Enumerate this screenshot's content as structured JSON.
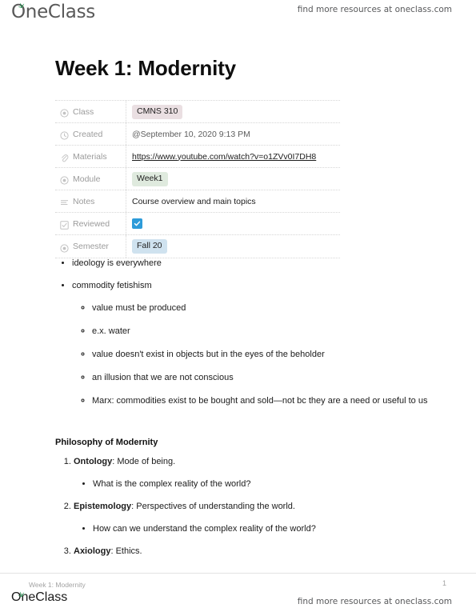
{
  "header": {
    "logo_text": "OneClass",
    "logo_icon": "leaf-sprout-icon",
    "tagline": "find more resources at oneclass.com"
  },
  "document": {
    "title": "Week 1: Modernity"
  },
  "properties": [
    {
      "icon": "circle-dot-icon",
      "key": "Class",
      "value": "CMNS 310",
      "style": "tag",
      "tag_color": "#eadfe2"
    },
    {
      "icon": "clock-icon",
      "key": "Created",
      "value": "@September 10, 2020 9:13 PM",
      "style": "plain"
    },
    {
      "icon": "paperclip-icon",
      "key": "Materials",
      "value": "https://www.youtube.com/watch?v=o1ZVv0I7DH8",
      "style": "link"
    },
    {
      "icon": "circle-dot-icon",
      "key": "Module",
      "value": "Week1",
      "style": "tag",
      "tag_color": "#dfeade"
    },
    {
      "icon": "text-lines-icon",
      "key": "Notes",
      "value": "Course overview and main topics",
      "style": "text"
    },
    {
      "icon": "checkbox-icon",
      "key": "Reviewed",
      "value": "checked",
      "style": "checkbox",
      "checkbox_color": "#2d9bd9"
    },
    {
      "icon": "circle-dot-icon",
      "key": "Semester",
      "value": "Fall 20",
      "style": "tag",
      "tag_color": "#cfe2ef"
    }
  ],
  "body": {
    "bullets": [
      {
        "text": "ideology is everywhere"
      },
      {
        "text": "commodity fetishism"
      }
    ],
    "sub_bullets": [
      {
        "text": "value must be produced"
      },
      {
        "text": "e.x. water"
      },
      {
        "text": "value doesn't exist in objects but in the eyes of the beholder"
      },
      {
        "text": "an illusion that we are not conscious"
      },
      {
        "text": "Marx: commodities exist to be bought and sold—not bc they are a need or useful to us"
      }
    ],
    "section_heading": "Philosophy of Modernity",
    "numbered_items": [
      {
        "term": "Ontology",
        "rest": ": Mode of being.",
        "sub": "What is the complex reality of the world?"
      },
      {
        "term": "Epistemology",
        "rest": ": Perspectives of understanding the world.",
        "sub": "How can we understand the complex reality of the world?"
      },
      {
        "term": "Axiology",
        "rest": ": Ethics.",
        "sub": null
      }
    ]
  },
  "footer": {
    "doc_title": "Week 1: Modernity",
    "page_number": "1",
    "logo_text": "OneClass",
    "tagline": "find more resources at oneclass.com"
  }
}
